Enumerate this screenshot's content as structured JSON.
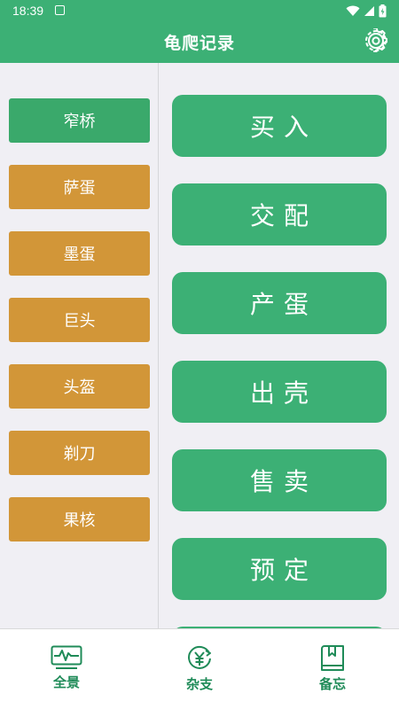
{
  "status_bar": {
    "time": "18:39"
  },
  "header": {
    "title": "龟爬记录"
  },
  "categories": [
    {
      "label": "窄桥",
      "state": "active"
    },
    {
      "label": "萨蛋",
      "state": "normal"
    },
    {
      "label": "墨蛋",
      "state": "normal"
    },
    {
      "label": "巨头",
      "state": "normal"
    },
    {
      "label": "头盔",
      "state": "normal"
    },
    {
      "label": "剃刀",
      "state": "normal"
    },
    {
      "label": "果核",
      "state": "normal"
    }
  ],
  "actions": [
    {
      "label": "买入"
    },
    {
      "label": "交配"
    },
    {
      "label": "产蛋"
    },
    {
      "label": "出壳"
    },
    {
      "label": "售卖"
    },
    {
      "label": "预定"
    },
    {
      "label": ""
    }
  ],
  "bottom_nav": [
    {
      "label": "全景",
      "icon": "monitor-chart-icon"
    },
    {
      "label": "杂支",
      "icon": "yen-coin-icon"
    },
    {
      "label": "备忘",
      "icon": "notebook-icon"
    }
  ],
  "colors": {
    "primary": "#3cb075",
    "category_active": "#3aa96b",
    "category_normal": "#d29638",
    "background": "#f0eff4",
    "nav_text": "#1f8b58"
  }
}
